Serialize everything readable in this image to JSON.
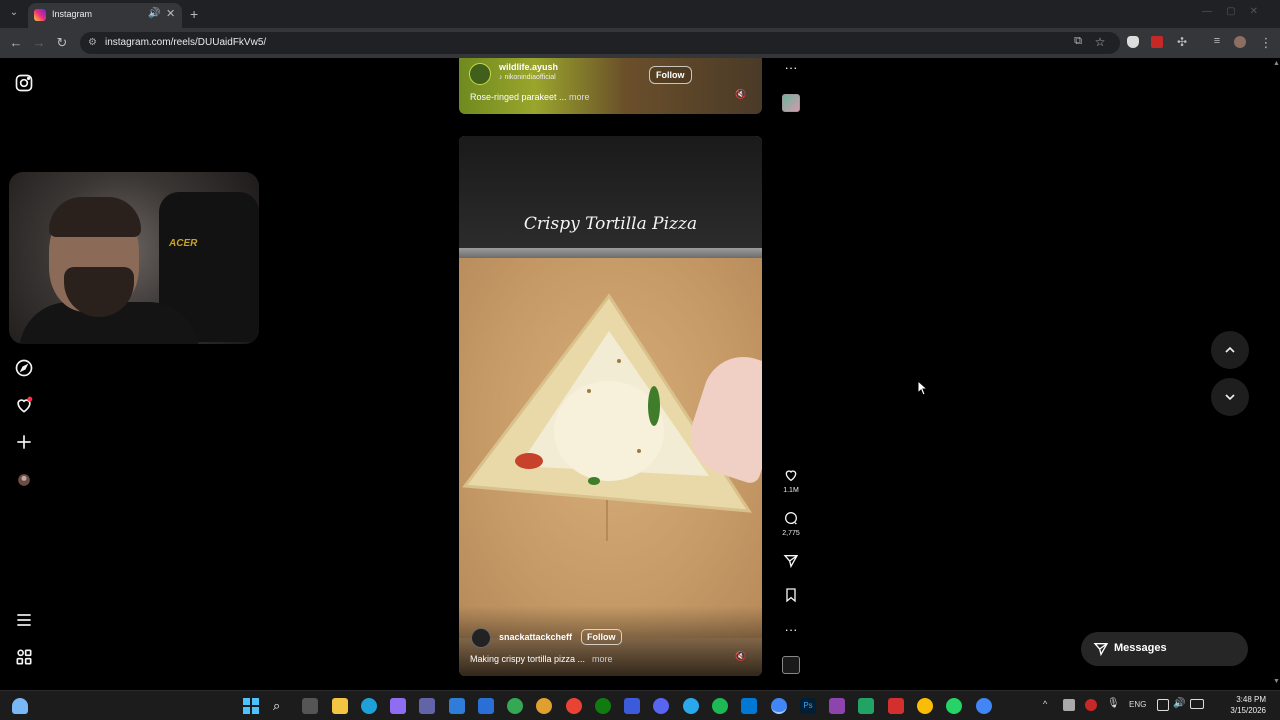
{
  "browser": {
    "tab_title": "Instagram",
    "url": "instagram.com/reels/DUUaidFkVw5/",
    "new_tab_label": "+",
    "tab_close": "✕",
    "tab_audio": "🔊"
  },
  "reels": {
    "top": {
      "username": "wildlife.ayush",
      "audio": "nikonindiaofficial",
      "follow_label": "Follow",
      "caption": "Rose-ringed parakeet ...",
      "more_label": "more"
    },
    "main": {
      "banner_title": "Crispy Tortilla Pizza",
      "username": "snackattackcheff",
      "follow_label": "Follow",
      "caption": "Making crispy tortilla pizza ...",
      "more_label": "more",
      "likes": "1.1M",
      "comments": "2,775"
    }
  },
  "webcam": {
    "chair_logo": "ACER"
  },
  "messages": {
    "label": "Messages"
  },
  "taskbar": {
    "language": "ENG",
    "time": "3:48 PM",
    "date": "3/15/2026"
  },
  "colors": {
    "background": "#000000",
    "chrome_dark": "#202124",
    "chrome_mid": "#35363a",
    "notification_dot": "#ff3040"
  }
}
